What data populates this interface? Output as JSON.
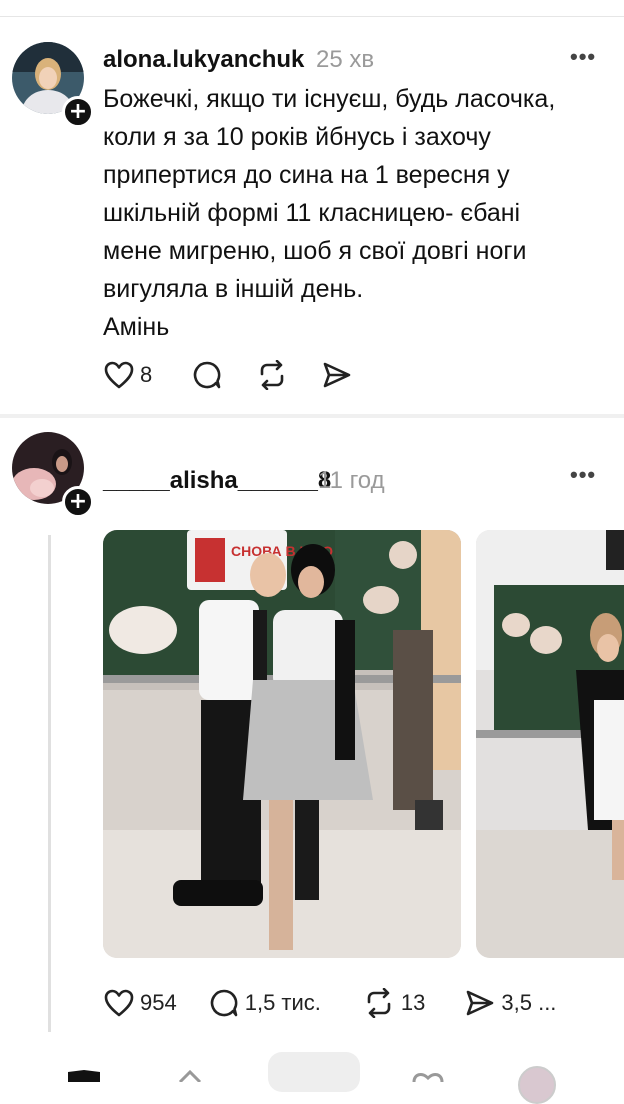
{
  "post1": {
    "username": "alona.lukyanchuk",
    "time": "25 хв",
    "lines": [
      "Божечкі, якщо ти існуєш, будь ласочка,",
      "коли я за 10 років йбнусь  і захочу",
      "припертися до сина на 1 вересня  у",
      "шкільній формі 11 класницею- єбані",
      "мене  мигреню, шоб я свої довгі  ноги",
      "вигуляла в іншій день.",
      "Амінь"
    ],
    "likes": "8",
    "icons": [
      "heart-icon",
      "comment-icon",
      "repost-icon",
      "share-icon"
    ]
  },
  "post2": {
    "username": "_____alisha______8",
    "time": "11 год",
    "photo_banner": "СНОВА В ШКО",
    "likes": "954",
    "comments": "1,5 тис.",
    "reposts": "13",
    "shares": "3,5 ...",
    "icons": [
      "heart-icon",
      "comment-icon",
      "repost-icon",
      "share-icon"
    ]
  },
  "menu": {
    "more": "•••"
  },
  "colors": {
    "text": "#111111",
    "muted": "#9a9a9a",
    "chalkboard": "#2c4a34",
    "divider": "#f0f0f0"
  }
}
